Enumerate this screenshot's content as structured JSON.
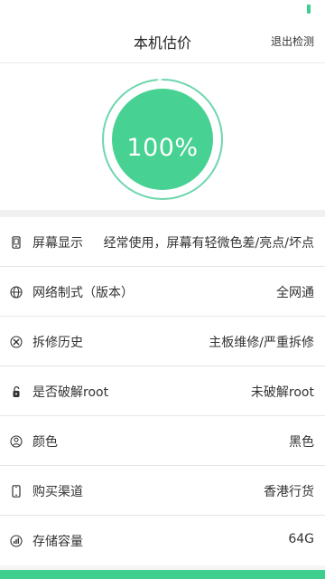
{
  "header": {
    "title": "本机估价",
    "exit_label": "退出检测"
  },
  "progress": {
    "value_text": "100%",
    "value": 1.0
  },
  "items": [
    {
      "icon": "screen-icon",
      "label": "屏幕显示",
      "value": "经常使用，屏幕有轻微色差/亮点/坏点"
    },
    {
      "icon": "globe-icon",
      "label": "网络制式（版本）",
      "value": "全网通"
    },
    {
      "icon": "tools-icon",
      "label": "拆修历史",
      "value": "主板维修/严重拆修"
    },
    {
      "icon": "unlock-icon",
      "label": "是否破解root",
      "value": "未破解root"
    },
    {
      "icon": "palette-icon",
      "label": "颜色",
      "value": "黑色"
    },
    {
      "icon": "phone-icon",
      "label": "购买渠道",
      "value": "香港行货"
    },
    {
      "icon": "storage-icon",
      "label": "存储容量",
      "value": "64G"
    }
  ],
  "colors": {
    "accent": "#3ecf8e",
    "ring": "#6fd7ae"
  }
}
